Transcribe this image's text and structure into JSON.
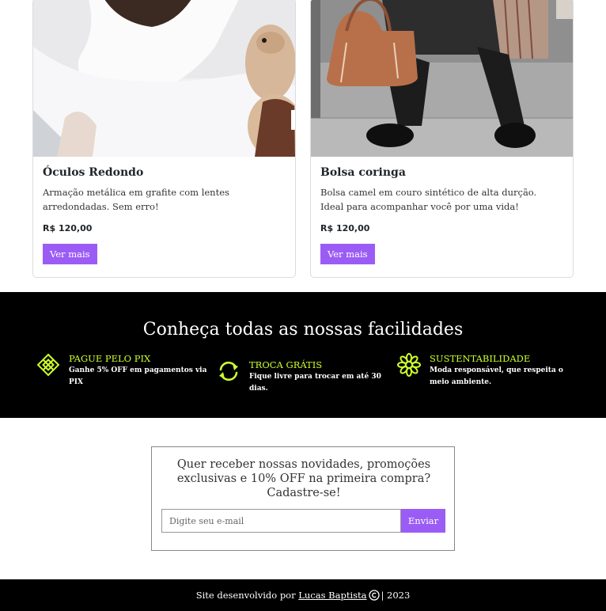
{
  "products": [
    {
      "image_icon": "woman-with-dog-photo",
      "title": "Óculos Redondo",
      "description": "Armação metálica em grafite com lentes arredondadas. Sem erro!",
      "price": "R$ 120,00",
      "button_label": "Ver mais"
    },
    {
      "image_icon": "camel-handbag-photo",
      "title": "Bolsa coringa",
      "description": "Bolsa camel em couro sintético de alta durção. Ideal para acompanhar você por uma vida!",
      "price": "R$ 120,00",
      "button_label": "Ver mais"
    }
  ],
  "facilities": {
    "title": "Conheça todas as nossas facilidades",
    "accent_color": "#cdff2c",
    "items": [
      {
        "icon": "diamond-grid-icon",
        "heading": "PAGUE PELO PIX",
        "text": "Ganhe 5% OFF em pagamentos via PIX"
      },
      {
        "icon": "exchange-arrows-icon",
        "heading": "TROCA GRÁTIS",
        "text": "Fique livre para trocar em até 30 dias."
      },
      {
        "icon": "flower-icon",
        "heading": "SUSTENTABILIDADE",
        "text": "Moda responsável, que respeita o meio ambiente."
      }
    ]
  },
  "newsletter": {
    "text": "Quer receber nossas novidades, promoções exclusivas e 10% OFF na primeira compra? Cadastre-se!",
    "placeholder": "Digite seu e-mail",
    "button_label": "Enviar",
    "button_color": "#9b5cf6"
  },
  "footer": {
    "prefix": "Site desenvolvido por",
    "author": "Lucas Baptista",
    "suffix": "| 2023"
  }
}
